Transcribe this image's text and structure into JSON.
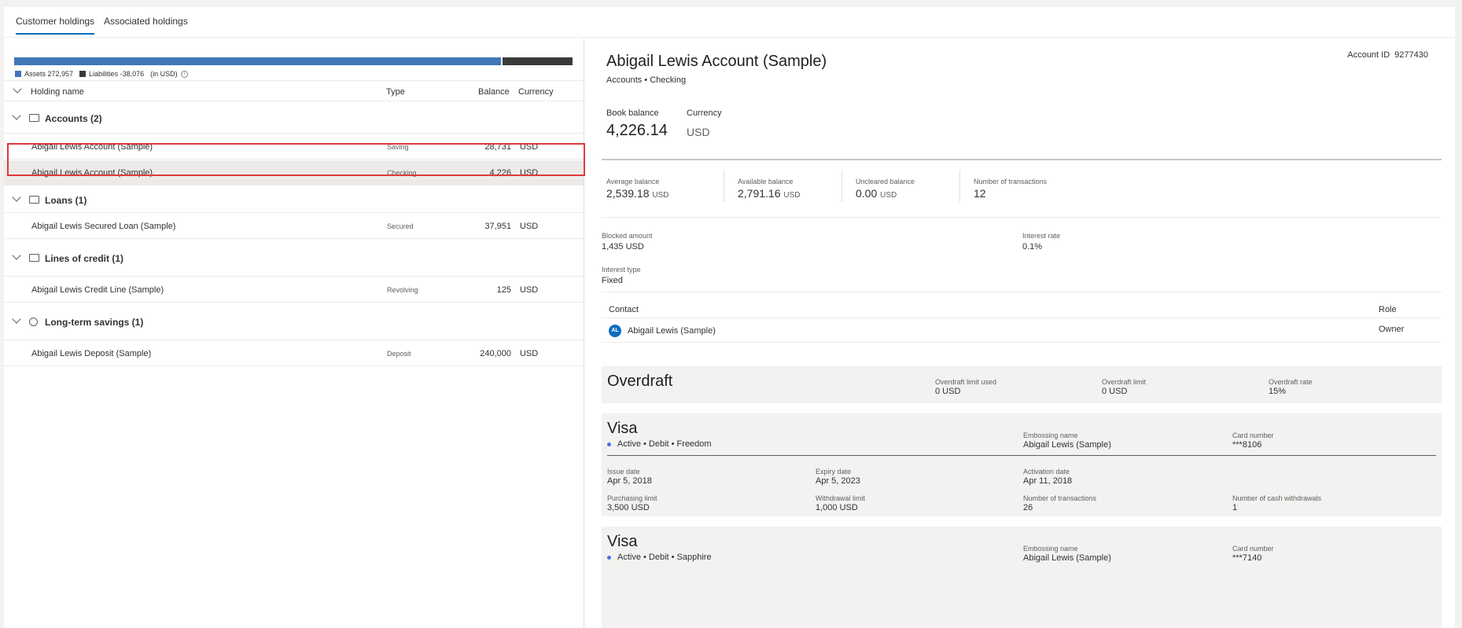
{
  "tabs": [
    {
      "label": "Customer holdings",
      "active": true
    },
    {
      "label": "Associated holdings",
      "active": false
    }
  ],
  "summary": {
    "assets_label": "Assets 272,957",
    "liabilities_label": "Liabilities -38,076",
    "currency_note": "(in USD)",
    "assets_color": "#4176b8",
    "liabilities_color": "#3b3a39"
  },
  "table": {
    "headers": {
      "name": "Holding name",
      "type": "Type",
      "balance": "Balance",
      "currency": "Currency"
    },
    "groups": [
      {
        "label": "Accounts (2)",
        "icon": "accounts-icon"
      },
      {
        "label": "Loans (1)",
        "icon": "loans-icon"
      },
      {
        "label": "Lines of credit (1)",
        "icon": "credit-card-icon"
      },
      {
        "label": "Long-term savings (1)",
        "icon": "savings-icon"
      }
    ],
    "rows": [
      {
        "name": "Abigail Lewis Account (Sample)",
        "type": "Saving",
        "balance": "28,731",
        "currency": "USD"
      },
      {
        "name": "Abigail Lewis Account (Sample)",
        "type": "Checking",
        "balance": "4,226",
        "currency": "USD"
      },
      {
        "name": "Abigail Lewis Secured Loan (Sample)",
        "type": "Secured",
        "balance": "37,951",
        "currency": "USD"
      },
      {
        "name": "Abigail Lewis Credit Line (Sample)",
        "type": "Revolving",
        "balance": "125",
        "currency": "USD"
      },
      {
        "name": "Abigail Lewis Deposit (Sample)",
        "type": "Deposit",
        "balance": "240,000",
        "currency": "USD"
      }
    ]
  },
  "detail": {
    "title": "Abigail Lewis Account (Sample)",
    "subtitle": "Accounts • Checking",
    "account_id_label": "Account ID",
    "account_id": "9277430",
    "book_balance_label": "Book balance",
    "book_balance": "4,226.14",
    "currency_label": "Currency",
    "currency": "USD",
    "stats": [
      {
        "label": "Average balance",
        "value": "2,539.18",
        "unit": "USD"
      },
      {
        "label": "Available balance",
        "value": "2,791.16",
        "unit": "USD"
      },
      {
        "label": "Uncleared balance",
        "value": "0.00",
        "unit": "USD"
      },
      {
        "label": "Number of transactions",
        "value": "12",
        "unit": ""
      }
    ],
    "blocked_label": "Blocked amount",
    "blocked_value": "1,435 USD",
    "interest_rate_label": "Interest rate",
    "interest_rate_value": "0.1%",
    "interest_type_label": "Interest type",
    "interest_type_value": "Fixed",
    "contact_header": "Contact",
    "role_header": "Role",
    "contact_initials": "AL",
    "contact_name": "Abigail Lewis (Sample)",
    "contact_role": "Owner"
  },
  "overdraft": {
    "title": "Overdraft",
    "limit_used_label": "Overdraft limit used",
    "limit_used_value": "0 USD",
    "limit_label": "Overdraft limit",
    "limit_value": "0 USD",
    "rate_label": "Overdraft rate",
    "rate_value": "15%"
  },
  "cards": [
    {
      "title": "Visa",
      "status": "Active • Debit • Freedom",
      "embossing_label": "Embossing name",
      "embossing_value": "Abigail Lewis (Sample)",
      "card_number_label": "Card number",
      "card_number_value": "***8106",
      "issue_label": "Issue date",
      "issue_value": "Apr 5, 2018",
      "expiry_label": "Expiry date",
      "expiry_value": "Apr 5, 2023",
      "activation_label": "Activation date",
      "activation_value": "Apr 11, 2018",
      "purchasing_label": "Purchasing limit",
      "purchasing_value": "3,500 USD",
      "withdrawal_label": "Withdrawal limit",
      "withdrawal_value": "1,000 USD",
      "transactions_label": "Number of transactions",
      "transactions_value": "26",
      "cash_label": "Number of cash withdrawals",
      "cash_value": "1"
    },
    {
      "title": "Visa",
      "status": "Active • Debit • Sapphire",
      "embossing_label": "Embossing name",
      "embossing_value": "Abigail Lewis (Sample)",
      "card_number_label": "Card number",
      "card_number_value": "***7140"
    }
  ]
}
